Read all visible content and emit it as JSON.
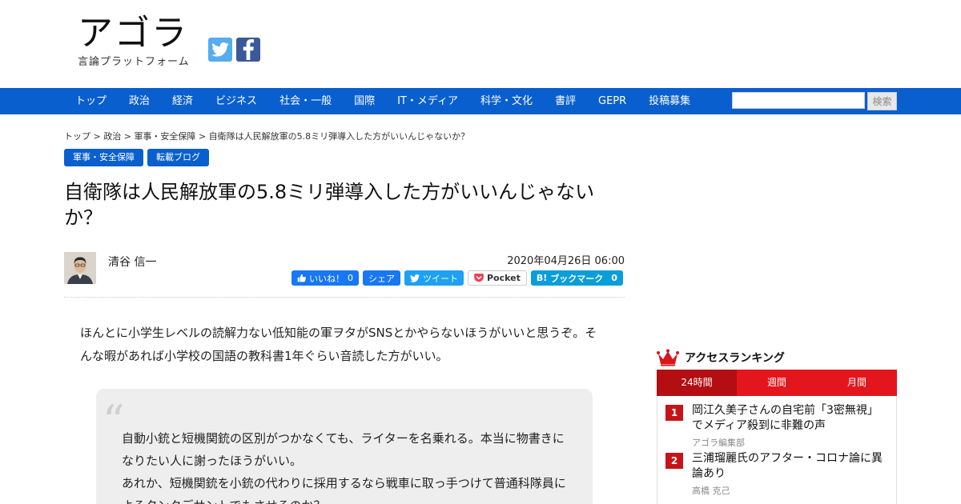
{
  "site": {
    "logo_main": "アゴラ",
    "logo_sub": "言論プラットフォーム"
  },
  "nav": {
    "items": [
      "トップ",
      "政治",
      "経済",
      "ビジネス",
      "社会・一般",
      "国際",
      "IT・メディア",
      "科学・文化",
      "書評",
      "GEPR",
      "投稿募集"
    ],
    "search_button": "検索"
  },
  "breadcrumb": {
    "items": [
      "トップ",
      "政治",
      "軍事・安全保障",
      "自衛隊は人民解放軍の5.8ミリ弾導入した方がいいんじゃないか？"
    ],
    "separator": ">"
  },
  "tags": [
    "軍事・安全保障",
    "転載ブログ"
  ],
  "article": {
    "title": "自衛隊は人民解放軍の5.8ミリ弾導入した方がいいんじゃないか？",
    "author": "清谷 信一",
    "date": "2020年04月26日 06:00",
    "paragraph": "ほんとに小学生レベルの読解力ない低知能の軍ヲタがSNSとかやらないほうがいいと思うぞ。そんな暇があれば小学校の国語の教科書1年ぐらい音読した方がいい。",
    "quote_mark": "“",
    "quote_lines": [
      "自動小銃と短機関銃の区別がつかなくても、ライターを名乗れる。本当に物書きになりたい人に謝ったほうがいい。",
      "あれか、短機関銃を小銃の代わりに採用するなら戦車に取っ手つけて普通科隊員によるタンクデサントでもさせるのか？"
    ]
  },
  "share": {
    "like_label": "いいね！",
    "like_count": "0",
    "share_label": "シェア",
    "tweet_label": "ツイート",
    "pocket_label": "Pocket",
    "hatena_label": "ブックマーク",
    "hatena_count": "0"
  },
  "ranking": {
    "title": "アクセスランキング",
    "tabs": [
      "24時間",
      "週間",
      "月間"
    ],
    "items": [
      {
        "rank": "1",
        "title": "岡江久美子さんの自宅前「3密無視」でメディア殺到に非難の声",
        "author": "アゴラ編集部"
      },
      {
        "rank": "2",
        "title": "三浦瑠麗氏のアフター・コロナ論に異論あり",
        "author": "高橋 克己"
      }
    ]
  },
  "colors": {
    "nav_blue": "#0a5fce",
    "rank_red": "#e3161d",
    "rank_red_dark": "#b40d12"
  }
}
